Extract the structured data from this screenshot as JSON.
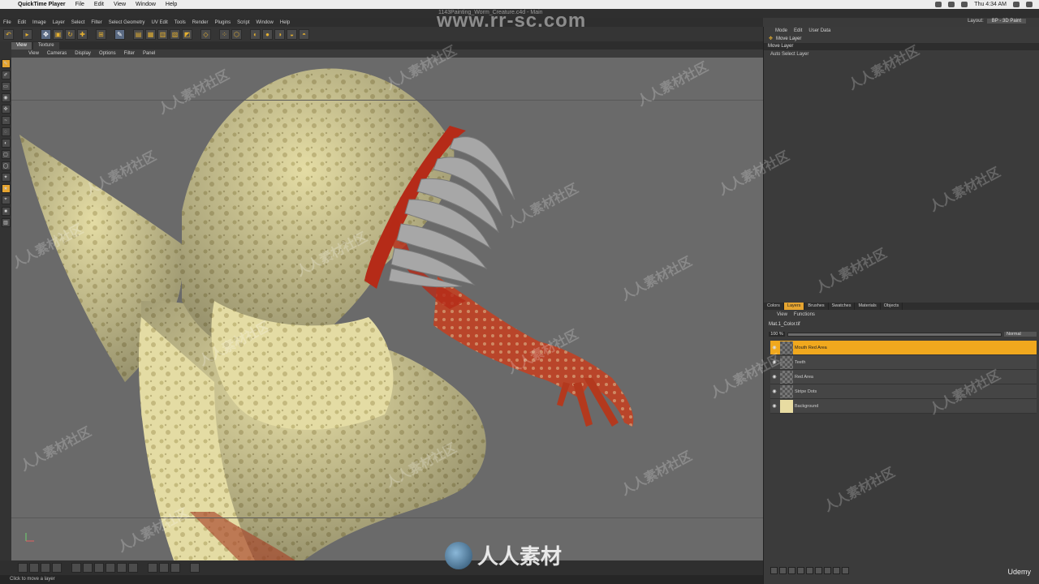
{
  "mac_menu": {
    "app": "QuickTime Player",
    "items": [
      "File",
      "Edit",
      "View",
      "Window",
      "Help"
    ],
    "clock": "Thu 4:34 AM"
  },
  "window_title": "1143Painting_Worm_Creature.c4d - Main",
  "c4d_menu": [
    "File",
    "Edit",
    "Image",
    "Layer",
    "Select",
    "Filter",
    "Select Geometry",
    "UV Edit",
    "Tools",
    "Render",
    "Plugins",
    "Script",
    "Window",
    "Help"
  ],
  "layout": {
    "label": "Layout:",
    "value": "BP - 3D Paint"
  },
  "viewport_tabs": [
    "View",
    "Texture"
  ],
  "view_menu": [
    "View",
    "Cameras",
    "Display",
    "Options",
    "Filter",
    "Panel"
  ],
  "attributes": {
    "menu": [
      "Mode",
      "Edit",
      "User Data"
    ],
    "tool_name": "Move Layer",
    "section": "Move Layer",
    "option": "Auto Select Layer"
  },
  "layers_panel": {
    "tabs": [
      "Colors",
      "Layers",
      "Brushes",
      "Swatches",
      "Materials",
      "Objects"
    ],
    "menu": [
      "View",
      "Functions"
    ],
    "texture": "Mat.1_Color.tif",
    "opacity": "100 %",
    "blend_mode": "Normal",
    "layers": [
      {
        "name": "Mouth Red Area",
        "selected": true
      },
      {
        "name": "Teeth",
        "selected": false
      },
      {
        "name": "Red Area",
        "selected": false
      },
      {
        "name": "Stripe Dots",
        "selected": false
      },
      {
        "name": "Background",
        "selected": false
      }
    ]
  },
  "status_text": "Click to move a layer",
  "watermark_site": "www.rr-sc.com",
  "watermark_text": "人人素材社区",
  "watermark_logo": "人人素材",
  "udemy": "Udemy",
  "colors": {
    "accent": "#f0a81e",
    "viewport_bg": "#6a6a6a",
    "panel_bg": "#3b3b3b",
    "creature_skin": "#e4dca4",
    "creature_red": "#b23a20"
  }
}
